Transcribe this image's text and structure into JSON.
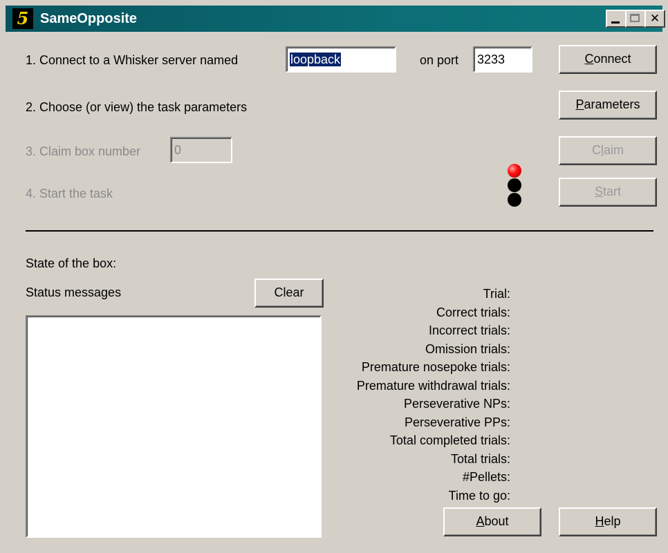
{
  "window": {
    "title": "SameOpposite",
    "icon_glyph": "5"
  },
  "step1": {
    "label": "1. Connect to a Whisker server named",
    "server_value": "loopback",
    "port_label": "on port",
    "port_value": "3233",
    "button_label": "Connect",
    "button_accel": "C",
    "button_rest": "onnect"
  },
  "step2": {
    "label": "2. Choose (or view) the task parameters",
    "button_accel": "P",
    "button_rest": "arameters"
  },
  "step3": {
    "label": "3. Claim box number",
    "box_value": "0",
    "button_pre": "C",
    "button_accel": "l",
    "button_rest": "aim"
  },
  "step4": {
    "label": "4. Start the task",
    "button_accel": "S",
    "button_rest": "tart"
  },
  "traffic_light": [
    "red",
    "black",
    "black"
  ],
  "box_state_label": "State of the box:",
  "status": {
    "label": "Status messages",
    "clear_label": "Clear"
  },
  "stats": [
    "Trial:",
    "Correct trials:",
    "Incorrect trials:",
    "Omission trials:",
    "Premature nosepoke trials:",
    "Premature withdrawal trials:",
    "Perseverative NPs:",
    "Perseverative PPs:",
    "Total completed trials:",
    "Total trials:",
    "#Pellets:",
    "Time to go:"
  ],
  "about": {
    "accel": "A",
    "rest": "bout"
  },
  "help": {
    "accel": "H",
    "rest": "elp"
  }
}
